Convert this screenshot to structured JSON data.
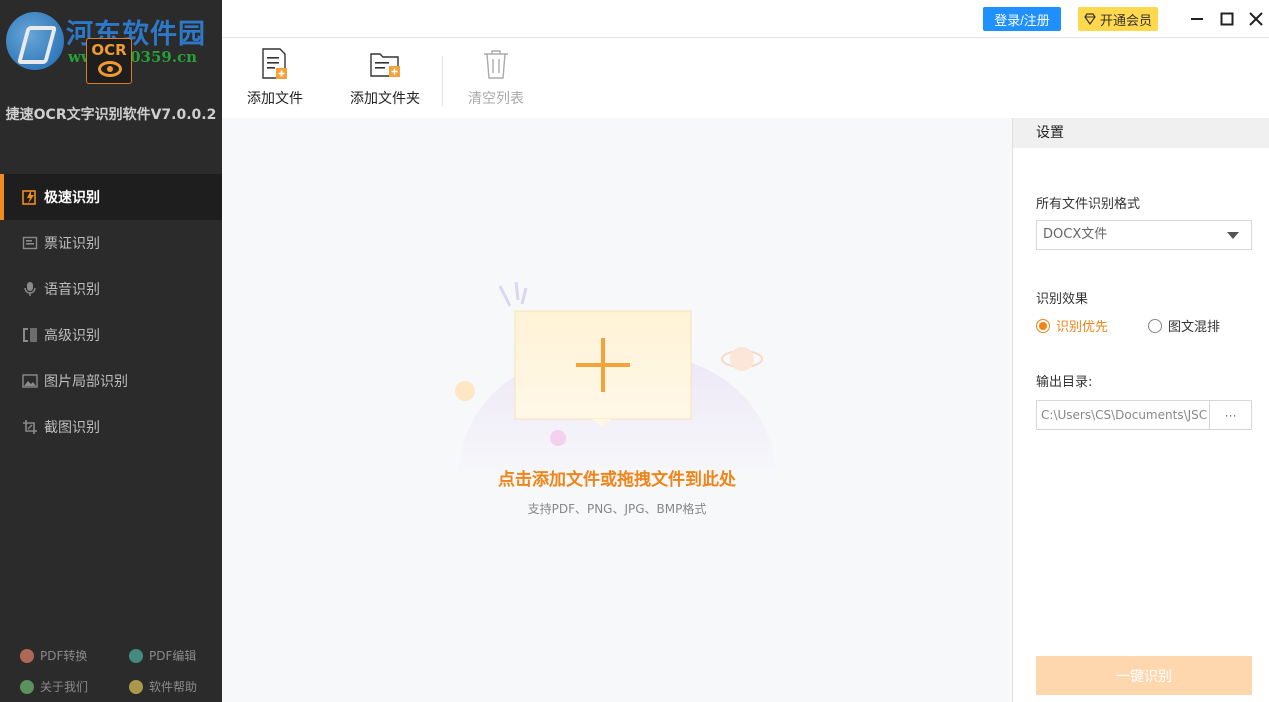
{
  "watermark": {
    "title": "河东软件园",
    "url": "www.pc0359.cn"
  },
  "logo": {
    "text": "OCR"
  },
  "app": {
    "name": "捷速OCR文字识别软件V7.0.0.2"
  },
  "nav": {
    "items": [
      {
        "label": "极速识别",
        "icon": "lightning-edit-icon",
        "active": true
      },
      {
        "label": "票证识别",
        "icon": "ticket-icon",
        "active": false
      },
      {
        "label": "语音识别",
        "icon": "microphone-icon",
        "active": false
      },
      {
        "label": "高级识别",
        "icon": "advanced-scan-icon",
        "active": false
      },
      {
        "label": "图片局部识别",
        "icon": "image-region-icon",
        "active": false
      },
      {
        "label": "截图识别",
        "icon": "screenshot-icon",
        "active": false
      }
    ]
  },
  "bottom_links": [
    {
      "label": "PDF转换",
      "icon": "pdf-convert-icon",
      "color": "#e8836b"
    },
    {
      "label": "PDF编辑",
      "icon": "pdf-edit-icon",
      "color": "#4fb3a6"
    },
    {
      "label": "关于我们",
      "icon": "about-icon",
      "color": "#6fbf73"
    },
    {
      "label": "软件帮助",
      "icon": "help-icon",
      "color": "#e3c75a"
    }
  ],
  "topbar": {
    "login_label": "登录/注册",
    "vip_label": "开通会员"
  },
  "toolbar": {
    "add_file": "添加文件",
    "add_folder": "添加文件夹",
    "clear_list": "清空列表"
  },
  "droparea": {
    "hint_main": "点击添加文件或拖拽文件到此处",
    "hint_sub": "支持PDF、PNG、JPG、BMP格式"
  },
  "settings": {
    "title": "设置",
    "format_label": "所有文件识别格式",
    "format_value": "DOCX文件",
    "effect_label": "识别效果",
    "effect_options": [
      "识别优先",
      "图文混排"
    ],
    "effect_selected": "识别优先",
    "output_label": "输出目录:",
    "output_path": "C:\\Users\\CS\\Documents\\JSC",
    "browse_label": "···",
    "run_label": "一键识别"
  },
  "colors": {
    "accent": "#f08419",
    "sidebar_bg": "#2b2b2b",
    "login_blue": "#1e90ff",
    "vip_yellow": "#ffd84d"
  }
}
